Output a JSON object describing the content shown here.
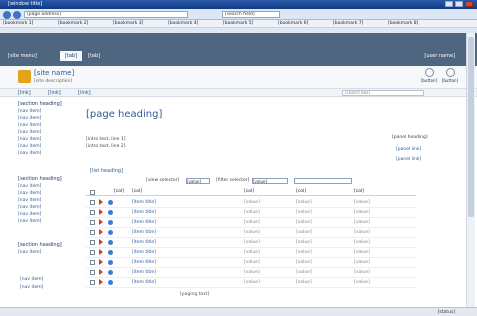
{
  "browser": {
    "window_title": "[window title]",
    "url": "[page address]",
    "search": "[search field]",
    "favorites": [
      "[bookmark 1]",
      "[bookmark 2]",
      "[bookmark 3]",
      "[bookmark 4]",
      "[bookmark 5]",
      "[bookmark 6]",
      "[bookmark 7]",
      "[bookmark 8]"
    ]
  },
  "ribbon": {
    "site_actions": "[site menu]",
    "browse": "[tab]",
    "page": "[tab]",
    "user": "[user name]"
  },
  "header": {
    "site_title": "[site name]",
    "site_desc": "[site description]",
    "buttons": [
      "[button]",
      "[button]"
    ]
  },
  "topnav": {
    "links": [
      "[link]",
      "[link]",
      "[link]"
    ],
    "search_placeholder": "[search box]"
  },
  "quicklaunch": {
    "section1": "[section heading]",
    "items1": [
      "[nav item]",
      "[nav item]",
      "[nav item]",
      "[nav item]",
      "[nav item]",
      "[nav item]",
      "[nav item]"
    ],
    "section2": "[section heading]",
    "items2": [
      "[nav item]",
      "[nav item]",
      "[nav item]",
      "[nav item]",
      "[nav item]",
      "[nav item]"
    ],
    "section3": "[section heading]",
    "items3": [
      "[nav item]"
    ],
    "recycle": "[nav item]",
    "all_content": "[nav item]"
  },
  "main": {
    "welcome": "[page heading]",
    "intro_line1": "[intro text, line 1]",
    "intro_line2": "[intro text, line 2]",
    "side_heading": "[panel heading]",
    "side_links": [
      "[panel link]",
      "[panel link]"
    ],
    "list_heading": "[list heading]",
    "view_label": "[view selector]",
    "view_value": "[value]",
    "filter_label": "[filter selector]",
    "filter_value": "[value]"
  },
  "table": {
    "columns": [
      "[col]",
      "[col]",
      "[col]",
      "[col]",
      "[col]"
    ],
    "rows": [
      {
        "title": "[item title]",
        "c1": "[value]",
        "c2": "[value]",
        "c3": "[value]"
      },
      {
        "title": "[item title]",
        "c1": "[value]",
        "c2": "[value]",
        "c3": "[value]"
      },
      {
        "title": "[item title]",
        "c1": "[value]",
        "c2": "[value]",
        "c3": "[value]"
      },
      {
        "title": "[item title]",
        "c1": "[value]",
        "c2": "[value]",
        "c3": "[value]"
      },
      {
        "title": "[item title]",
        "c1": "[value]",
        "c2": "[value]",
        "c3": "[value]"
      },
      {
        "title": "[item title]",
        "c1": "[value]",
        "c2": "[value]",
        "c3": "[value]"
      },
      {
        "title": "[item title]",
        "c1": "[value]",
        "c2": "[value]",
        "c3": "[value]"
      },
      {
        "title": "[item title]",
        "c1": "[value]",
        "c2": "[value]",
        "c3": "[value]"
      },
      {
        "title": "[item title]",
        "c1": "[value]",
        "c2": "[value]",
        "c3": "[value]"
      }
    ],
    "pager": "[paging text]"
  },
  "statusbar": {
    "text": "[status]"
  },
  "colors": {
    "ribbon": "#4f6681",
    "accent": "#2b5a8f",
    "logo": "#e3a31a",
    "flag": "#d33a2c",
    "status_dot": "#3b7bd6"
  }
}
